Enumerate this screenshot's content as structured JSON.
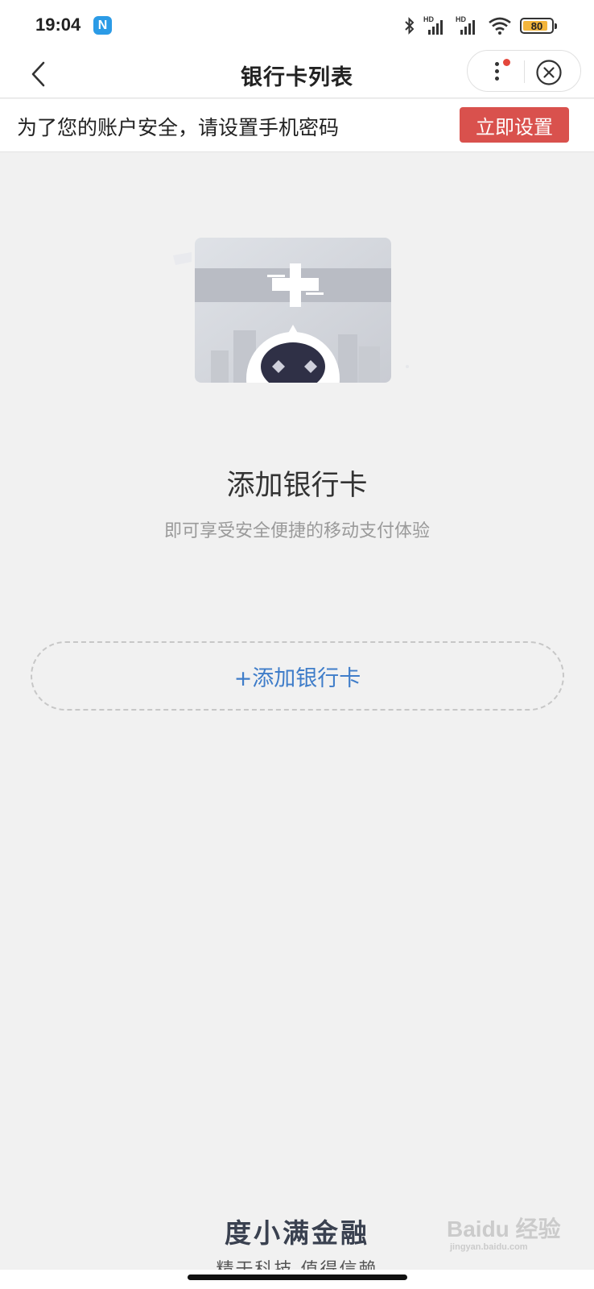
{
  "status_bar": {
    "time": "19:04",
    "app_badge_letter": "N",
    "battery_level": "80",
    "icons": [
      "bluetooth-icon",
      "hd-signal-icon",
      "hd-signal-icon",
      "wifi-icon",
      "battery-icon"
    ]
  },
  "nav": {
    "title": "银行卡列表",
    "back_icon": "chevron-left-icon",
    "more_icon": "more-vertical-icon",
    "close_icon": "close-circle-icon"
  },
  "notice": {
    "text": "为了您的账户安全，请设置手机密码",
    "button_label": "立即设置"
  },
  "empty_state": {
    "illustration": "bank-card-robot-illustration",
    "title": "添加银行卡",
    "subtitle": "即可享受安全便捷的移动支付体验",
    "add_button_label": "+添加银行卡"
  },
  "footer": {
    "brand": "度小满金融",
    "slogan": "精于科技 值得信赖"
  },
  "watermark": {
    "text": "Baidu 经验",
    "subtext": "jingyan.baidu.com"
  },
  "colors": {
    "accent_red": "#d9514d",
    "link_blue": "#3f7dc9",
    "background": "#f1f1f1",
    "battery_fill": "#f3b53b"
  }
}
